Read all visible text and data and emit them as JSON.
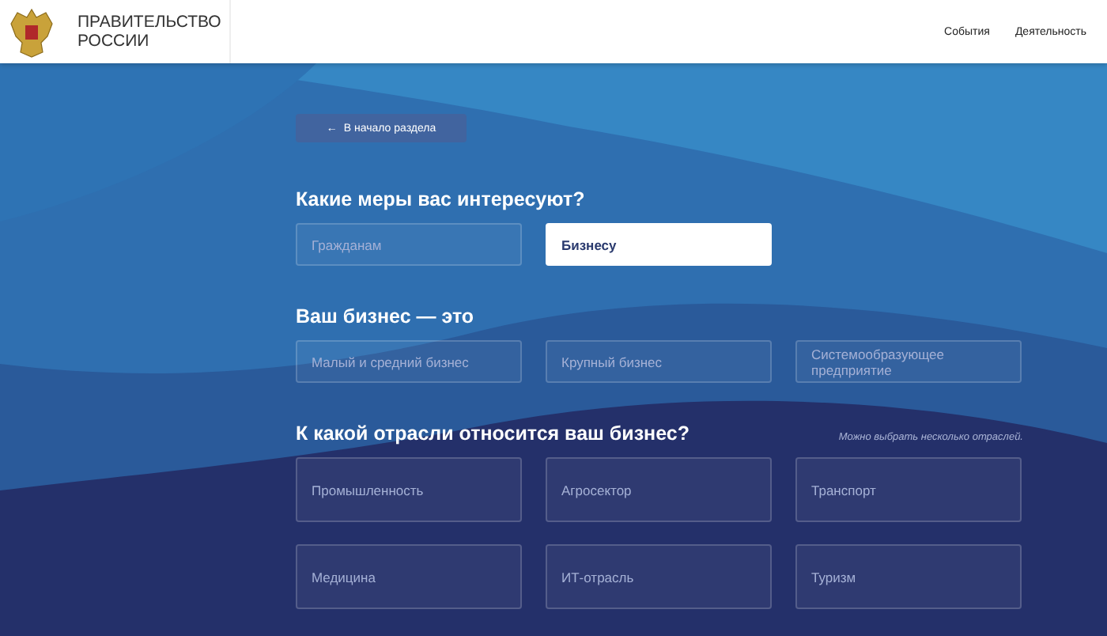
{
  "header": {
    "title_lines": [
      "ПРАВИТЕЛЬСТВО",
      "РОССИИ"
    ],
    "nav": [
      "События",
      "Деятельность"
    ]
  },
  "back_button": {
    "arrow": "←",
    "label": "В начало раздела"
  },
  "sections": [
    {
      "title": "Какие меры вас интересуют?",
      "options": [
        {
          "label": "Гражданам",
          "selected": false
        },
        {
          "label": "Бизнесу",
          "selected": true
        }
      ]
    },
    {
      "title": "Ваш бизнес — это",
      "options": [
        {
          "label": "Малый и средний бизнес",
          "selected": false
        },
        {
          "label": "Крупный бизнес",
          "selected": false
        },
        {
          "label": "Системообразующее предприятие",
          "selected": false
        }
      ]
    },
    {
      "title": "К какой отрасли относится ваш бизнес?",
      "note": "Можно выбрать несколько отраслей.",
      "kind": "tiles",
      "options": [
        {
          "label": "Промышленность",
          "selected": false
        },
        {
          "label": "Агросектор",
          "selected": false
        },
        {
          "label": "Транспорт",
          "selected": false
        },
        {
          "label": "Медицина",
          "selected": false
        },
        {
          "label": "ИТ-отрасль",
          "selected": false
        },
        {
          "label": "Туризм",
          "selected": false
        }
      ]
    }
  ]
}
